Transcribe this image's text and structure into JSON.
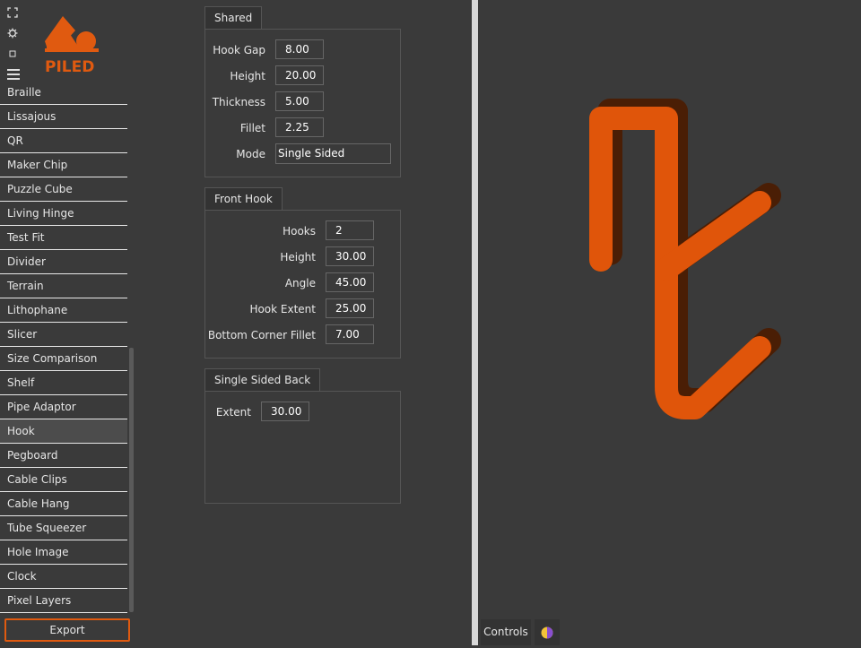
{
  "sidebar": {
    "logo_text": "PILED",
    "top_icons": [
      "fullscreen-icon",
      "settings-icon",
      "window-icon"
    ],
    "menu_items": [
      "Braille",
      "Lissajous",
      "QR",
      "Maker Chip",
      "Puzzle Cube",
      "Living Hinge",
      "Test Fit",
      "Divider",
      "Terrain",
      "Lithophane",
      "Slicer",
      "Size Comparison",
      "Shelf",
      "Pipe Adaptor",
      "Hook",
      "Pegboard",
      "Cable Clips",
      "Cable Hang",
      "Tube Squeezer",
      "Hole Image",
      "Clock",
      "Pixel Layers"
    ],
    "selected_item": "Hook",
    "export_label": "Export"
  },
  "panels": {
    "shared": {
      "title": "Shared",
      "hook_gap_label": "Hook Gap",
      "hook_gap": "8.00",
      "height_label": "Height",
      "height": "20.00",
      "thickness_label": "Thickness",
      "thickness": "5.00",
      "fillet_label": "Fillet",
      "fillet": "2.25",
      "mode_label": "Mode",
      "mode": "Single Sided"
    },
    "front_hook": {
      "title": "Front Hook",
      "hooks_label": "Hooks",
      "hooks": "2",
      "height_label": "Height",
      "height": "30.00",
      "angle_label": "Angle",
      "angle": "45.00",
      "hook_extent_label": "Hook Extent",
      "hook_extent": "25.00",
      "bottom_corner_fillet_label": "Bottom Corner Fillet",
      "bottom_corner_fillet": "7.00"
    },
    "single_sided_back": {
      "title": "Single Sided Back",
      "extent_label": "Extent",
      "extent": "30.00"
    }
  },
  "viewport": {
    "controls_label": "Controls",
    "theme_icon": "theme-toggle-icon",
    "model_color": "#e0550a",
    "model_shadow_color": "#4a1e05"
  },
  "colors": {
    "background": "#3a3a3a",
    "accent": "#e05a10",
    "divider": "#d8d8d8"
  }
}
